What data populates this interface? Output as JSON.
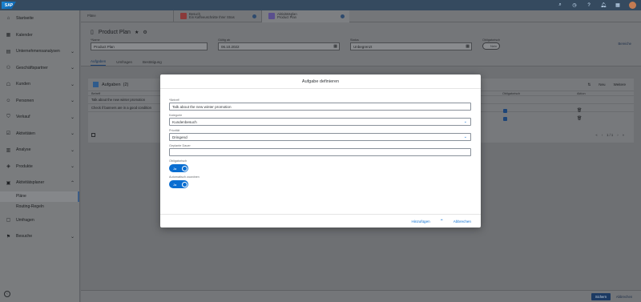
{
  "shell": {
    "logo": "SAP",
    "icons": [
      "search-icon",
      "history-icon",
      "help-icon",
      "notifications-icon",
      "apps-icon",
      "avatar"
    ]
  },
  "sidebar": {
    "items": [
      {
        "label": "Startseite",
        "icon": "home-icon"
      },
      {
        "label": "Kalender",
        "icon": "calendar-icon"
      },
      {
        "label": "Unternehmensanalysen",
        "icon": "analytics-icon"
      },
      {
        "label": "Geschäftspartner",
        "icon": "partner-icon"
      },
      {
        "label": "Kunden",
        "icon": "customer-icon"
      },
      {
        "label": "Personen",
        "icon": "people-icon"
      },
      {
        "label": "Verkauf",
        "icon": "sales-icon"
      },
      {
        "label": "Aktivitäten",
        "icon": "activity-icon"
      },
      {
        "label": "Analyse",
        "icon": "chart-icon"
      },
      {
        "label": "Produkte",
        "icon": "product-icon"
      },
      {
        "label": "Aktivitätsplaner",
        "icon": "planner-icon"
      }
    ],
    "subitems": [
      "Pläne",
      "Routing-Regeln"
    ],
    "after": [
      {
        "label": "Umfragen",
        "icon": "survey-icon"
      },
      {
        "label": "Besuche",
        "icon": "visit-icon"
      }
    ]
  },
  "tabs": {
    "t1": "Pläne",
    "t2_line1": "Besuch",
    "t2_line2": "Ein Kaffeeuschnitte Ihrer Stras",
    "t3_line1": "Aktivitätsplan",
    "t3_line2": "Product Plan"
  },
  "header": {
    "title": "Product Plan",
    "bereich": "Bereiche",
    "fields": {
      "name_label": "*Name",
      "name_value": "Product Plan",
      "gueltig_label": "Gültig ab",
      "gueltig_value": "06.10.2022",
      "status_label": "Status",
      "status_value": "Unbegrenzt",
      "obligatorisch_label": "Obligatorisch",
      "obligatorisch_value": "Nein"
    }
  },
  "subtabs": [
    "Aufgaben",
    "Umfragen",
    "Bestätigung"
  ],
  "table": {
    "title": "Aufgaben",
    "count": "(2)",
    "actions": [
      "Neu",
      "Weitere"
    ],
    "col_betreff": "Betreff",
    "col_obligatorisch": "Obligatorisch",
    "col_aktion": "Aktion",
    "rows": [
      "Talk about the new winter promotion",
      "Check if banners are in a good condition"
    ],
    "pager": "1 / 1"
  },
  "footer": {
    "save": "Sichern",
    "cancel": "Abbrechen"
  },
  "dialog": {
    "title": "Aufgabe definieren",
    "betreff_label": "*Betreff",
    "betreff_value": "Talk about the new winter promotion",
    "kategorie_label": "Kategorie",
    "kategorie_value": "Kundenbesuch",
    "prioritaet_label": "Priorität",
    "prioritaet_value": "Dringend",
    "dauer_label": "Geplante Dauer",
    "dauer_value": "",
    "obligatorisch_label": "Obligatorisch",
    "obligatorisch_value": "Ja",
    "auto_label": "Automatisch zuordnen",
    "auto_value": "Ja",
    "hinzufuegen": "Hinzufügen",
    "abbrechen": "Abbrechen"
  },
  "colors": {
    "shell": "#354a5f",
    "accent": "#0a6ed1",
    "overlay": "#6b6d70"
  }
}
